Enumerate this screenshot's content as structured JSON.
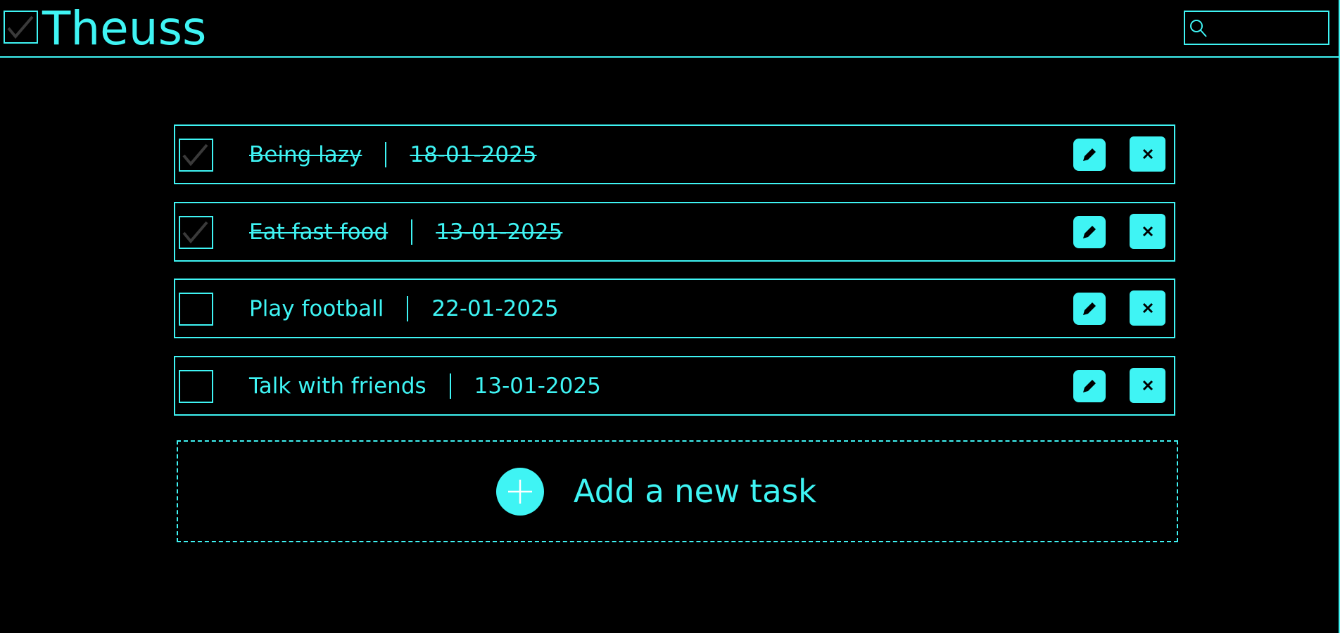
{
  "header": {
    "app_title": "Theuss",
    "logo_icon": "checkbox-checked-icon",
    "search": {
      "placeholder": "",
      "value": "",
      "icon": "search-icon"
    }
  },
  "colors": {
    "accent": "#3ff4f4",
    "background": "#000000",
    "check_mark": "#3a3a3a"
  },
  "tasks": [
    {
      "name": "Being lazy",
      "date": "18-01-2025",
      "completed": true
    },
    {
      "name": "Eat fast food",
      "date": "13-01-2025",
      "completed": true
    },
    {
      "name": "Play football",
      "date": "22-01-2025",
      "completed": false
    },
    {
      "name": "Talk with friends",
      "date": "13-01-2025",
      "completed": false
    }
  ],
  "task_actions": {
    "edit_icon": "pencil-icon",
    "delete_icon": "close-icon"
  },
  "add_task": {
    "label": "Add a new task",
    "icon": "plus-icon"
  }
}
